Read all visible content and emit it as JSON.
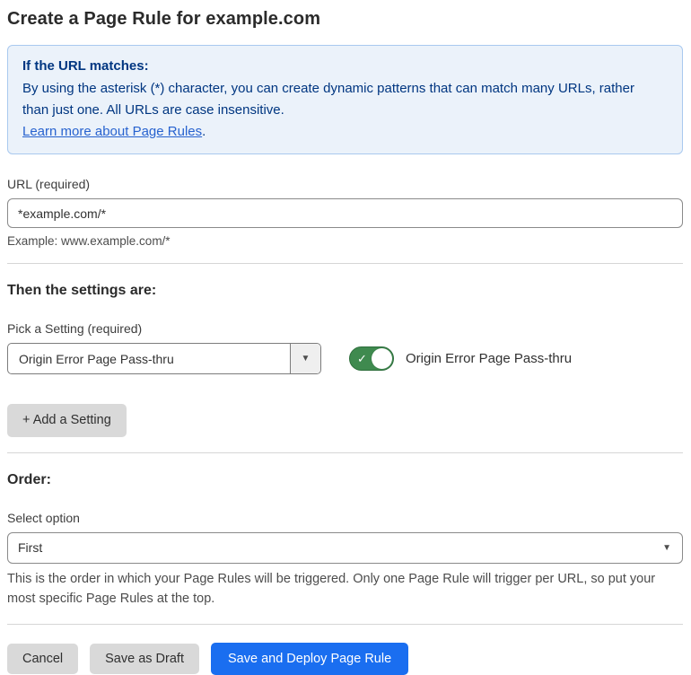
{
  "page": {
    "title": "Create a Page Rule for example.com"
  },
  "info_box": {
    "heading": "If the URL matches:",
    "body": "By using the asterisk (*) character, you can create dynamic patterns that can match many URLs, rather than just one. All URLs are case insensitive.",
    "link_label": "Learn more about Page Rules",
    "link_suffix": "."
  },
  "url_field": {
    "label": "URL (required)",
    "value": "*example.com/*",
    "helper": "Example: www.example.com/*"
  },
  "settings_section": {
    "heading": "Then the settings are:",
    "picker_label": "Pick a Setting (required)",
    "selected_setting": "Origin Error Page Pass-thru",
    "caret_icon": "▼",
    "toggle": {
      "state": "on",
      "check_icon": "✓",
      "label": "Origin Error Page Pass-thru"
    },
    "add_button_label": "+ Add a Setting"
  },
  "order_section": {
    "heading": "Order:",
    "select_label": "Select option",
    "selected_option": "First",
    "caret_icon": "▼",
    "helper": "This is the order in which your Page Rules will be triggered. Only one Page Rule will trigger per URL, so put your most specific Page Rules at the top."
  },
  "footer": {
    "cancel_label": "Cancel",
    "save_draft_label": "Save as Draft",
    "save_deploy_label": "Save and Deploy Page Rule"
  },
  "colors": {
    "accent_blue": "#1a6ef0",
    "info_bg": "#ebf2fa",
    "info_border": "#a9c9ef",
    "info_text": "#003681",
    "link_blue": "#2762cf",
    "toggle_green_on": "#3f8a4f",
    "button_gray": "#d9d9d9"
  }
}
